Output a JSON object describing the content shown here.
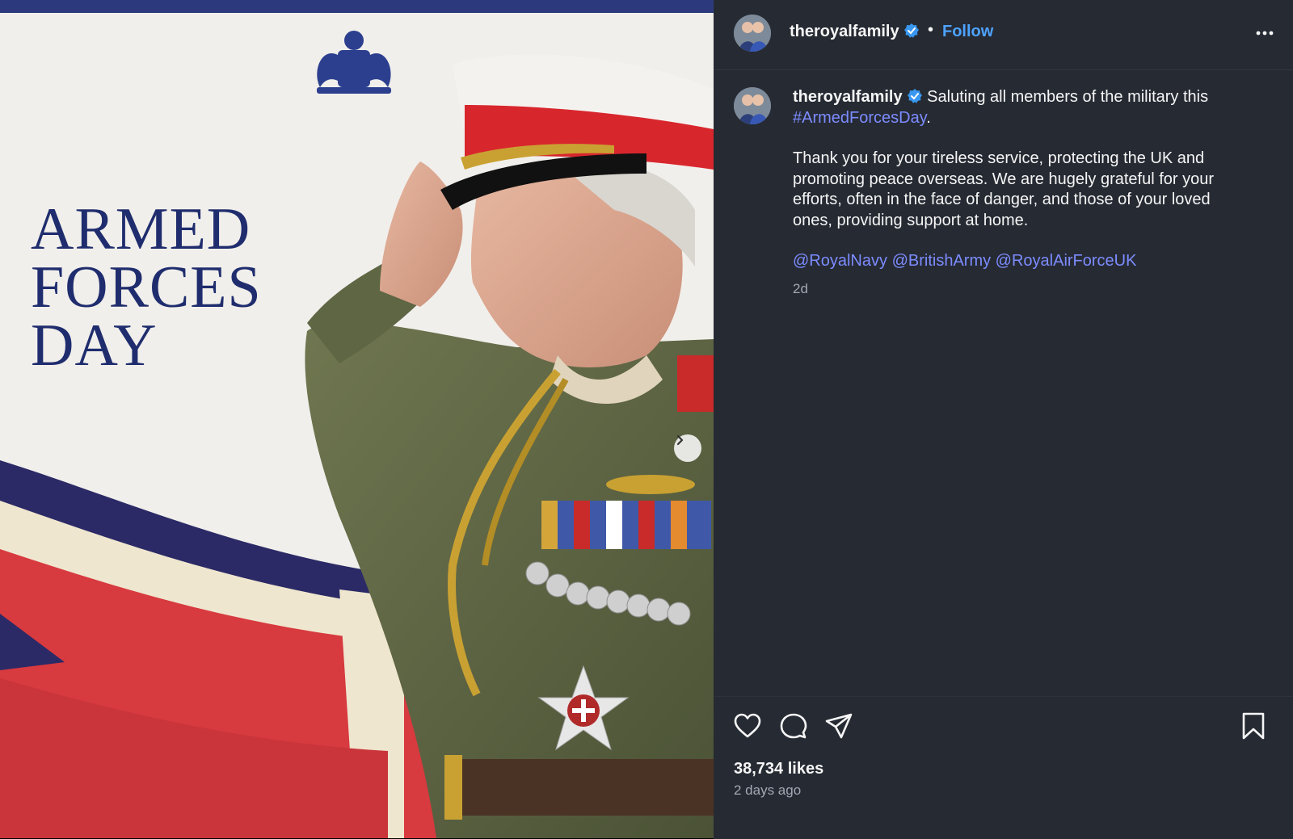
{
  "post": {
    "image_text": [
      "ARMED",
      "FORCES",
      "DAY"
    ]
  },
  "author": {
    "username": "theroyalfamily",
    "follow_label": "Follow"
  },
  "caption": {
    "username": "theroyalfamily",
    "line1": "Saluting all members of the military this",
    "hashtag": "#ArmedForcesDay",
    "hashtag_suffix": ".",
    "paragraph": "Thank you for your tireless service, protecting the UK and promoting peace overseas. We are hugely grateful for your efforts, often in the face of danger, and those of your loved ones, providing support at home.",
    "mentions": [
      "@RoyalNavy",
      "@BritishArmy",
      "@RoyalAirForceUK"
    ],
    "age": "2d"
  },
  "footer": {
    "likes": "38,734 likes",
    "posted": "2 days ago"
  },
  "icons": {
    "verified": "verified-badge-icon",
    "more": "more-options-icon",
    "like": "heart-icon",
    "comment": "comment-icon",
    "share": "share-icon",
    "save": "bookmark-icon",
    "next": "chevron-right-icon"
  },
  "colors": {
    "panel_bg": "#262a33",
    "link": "#7c8cff",
    "follow": "#4da3ff",
    "verified": "#3897f0",
    "title_navy": "#1f2d6e"
  }
}
